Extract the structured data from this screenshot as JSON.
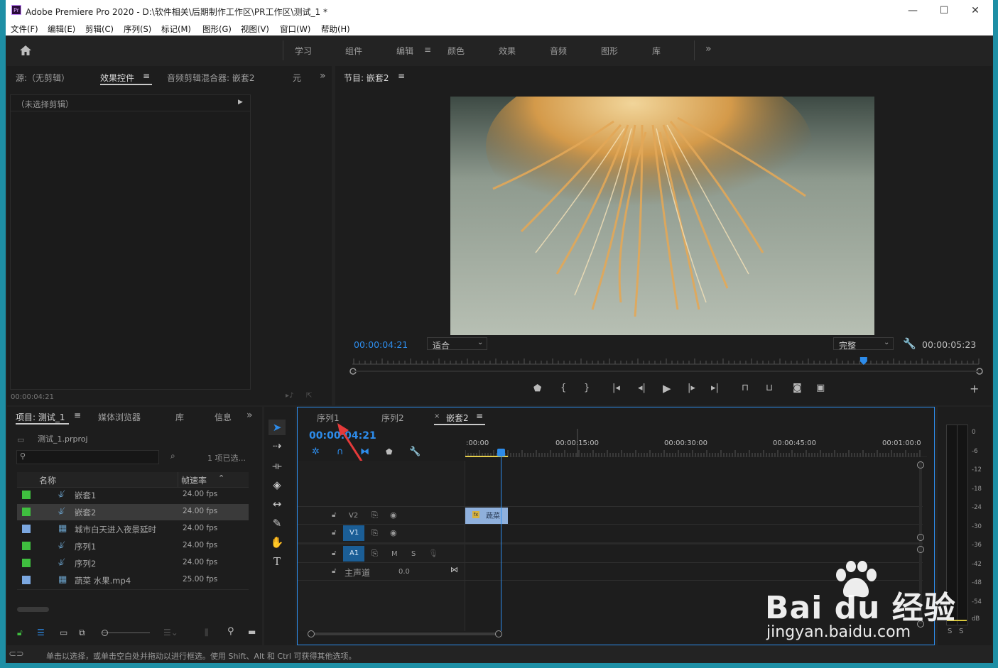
{
  "window": {
    "app_icon": "Pr",
    "title": "Adobe Premiere Pro 2020 - D:\\软件相关\\后期制作工作区\\PR工作区\\测试_1 *",
    "minimize": "—",
    "maximize": "☐",
    "close": "✕"
  },
  "menu": [
    "文件(F)",
    "编辑(E)",
    "剪辑(C)",
    "序列(S)",
    "标记(M)",
    "图形(G)",
    "视图(V)",
    "窗口(W)",
    "帮助(H)"
  ],
  "workspaces": {
    "items": [
      "学习",
      "组件",
      "编辑",
      "颜色",
      "效果",
      "音频",
      "图形",
      "库"
    ],
    "active": "编辑",
    "more": "»"
  },
  "source_panel": {
    "tabs": [
      "源:（无剪辑）",
      "效果控件",
      "音频剪辑混合器: 嵌套2",
      "元"
    ],
    "active": "效果控件",
    "no_clip": "（未选择剪辑）",
    "timecode": "00:00:04:21"
  },
  "program_monitor": {
    "title": "节目: 嵌套2",
    "timecode": "00:00:04:21",
    "fit": "适合",
    "quality": "完整",
    "duration": "00:00:05:23",
    "playhead_fraction": 0.815
  },
  "project_panel": {
    "tabs": [
      "项目: 测试_1",
      "媒体浏览器",
      "库",
      "信息"
    ],
    "active": "项目: 测试_1",
    "file": "测试_1.prproj",
    "selected_count": "1 项已选...",
    "col_name": "名称",
    "col_fps": "帧速率",
    "items": [
      {
        "name": "嵌套1",
        "fps": "24.00 fps",
        "color": "#3fbf3f",
        "icon": "sequence-icon"
      },
      {
        "name": "嵌套2",
        "fps": "24.00 fps",
        "color": "#3fbf3f",
        "icon": "sequence-icon"
      },
      {
        "name": "城市白天进入夜景延时",
        "fps": "24.00 fps",
        "color": "#7ba7e0",
        "icon": "video-clip-icon"
      },
      {
        "name": "序列1",
        "fps": "24.00 fps",
        "color": "#3fbf3f",
        "icon": "sequence-icon"
      },
      {
        "name": "序列2",
        "fps": "24.00 fps",
        "color": "#3fbf3f",
        "icon": "sequence-icon"
      },
      {
        "name": "蔬菜 水果.mp4",
        "fps": "25.00 fps",
        "color": "#7ba7e0",
        "icon": "video-clip-icon"
      }
    ],
    "selected_index": 1
  },
  "timeline": {
    "tabs": [
      "序列1",
      "序列2",
      "嵌套2"
    ],
    "active": "嵌套2",
    "timecode": "00:00:04:21",
    "ruler": [
      ":00:00",
      "00:00:15:00",
      "00:00:30:00",
      "00:00:45:00",
      "00:01:00:0"
    ],
    "tracks": {
      "v2": "V2",
      "v1": "V1",
      "a1": "A1",
      "m": "M",
      "s": "S",
      "master": "主声道",
      "master_value": "0.0"
    },
    "clip_label": "蔬菜"
  },
  "meter": {
    "scale": [
      "0",
      "-6",
      "-12",
      "-18",
      "-24",
      "-30",
      "-36",
      "-42",
      "-48",
      "-54",
      "dB"
    ],
    "solo": "S"
  },
  "status": "单击以选择，或单击空白处并拖动以进行框选。使用 Shift、Alt 和 Ctrl 可获得其他选项。",
  "watermark": {
    "logo": "Bai du 经验",
    "url": "jingyan.baidu.com"
  },
  "colors": {
    "accent": "#2d8ceb",
    "sequence": "#3fbf3f",
    "clip": "#7ba7e0"
  }
}
